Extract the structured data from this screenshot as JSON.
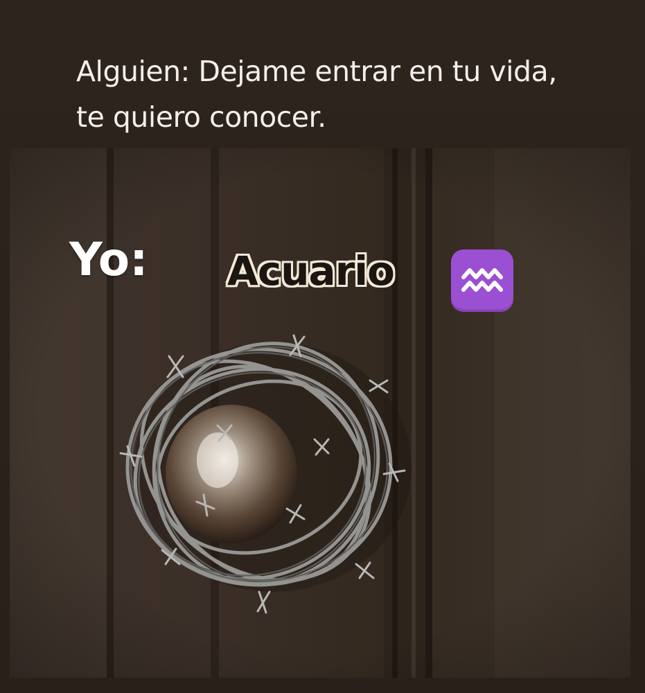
{
  "meme": {
    "caption_line1": "Alguien: Dejame entrar en tu vida,",
    "caption_line2": "te quiero conocer.",
    "label_me": "Yo:",
    "label_sign": "Acuario",
    "sign_icon": "aquarius-icon",
    "colors": {
      "background": "#2b221c",
      "caption_text": "#f2efec",
      "sign_outline": "#f4ead8",
      "zodiac_tile": "#9b4fd3"
    }
  }
}
